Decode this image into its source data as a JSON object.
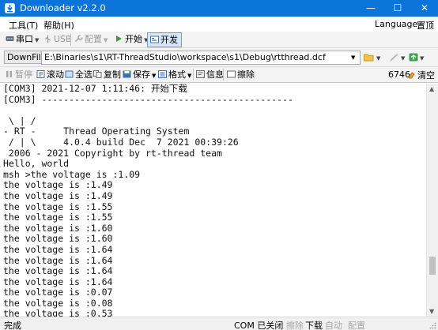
{
  "window": {
    "title": "Downloader v2.2.0",
    "minimize": "—",
    "maximize": "☐",
    "close": "✕"
  },
  "menu": {
    "tools": "工具(T)",
    "help": "帮助(H)",
    "language": "Language",
    "skin": "置顶"
  },
  "toolbar": {
    "serial": "串口",
    "usb": "USB",
    "config": "配置",
    "start": "开始",
    "develop": "开发",
    "dropdown_arrow": "▼"
  },
  "filebar": {
    "label": "DownFile",
    "path": "E:\\Binaries\\s1\\RT-ThreadStudio\\workspace\\s1\\Debug\\rtthread.dcf"
  },
  "toolbar2": {
    "pause": "暂停",
    "scroll": "滚动",
    "select_all": "全选",
    "copy": "复制",
    "save": "保存",
    "format": "格式",
    "info": "信息",
    "erase": "擦除",
    "count": "6746",
    "clear": "清空"
  },
  "console": {
    "lines": [
      "[COM3] 2021-12-07 1:11:46: 开始下载",
      "[COM3] ----------------------------------------------",
      "",
      " \\ | /",
      "- RT -     Thread Operating System",
      " / | \\     4.0.4 build Dec  7 2021 00:39:26",
      " 2006 - 2021 Copyright by rt-thread team",
      "Hello, world",
      "msh >the voltage is :1.09",
      "the voltage is :1.49",
      "the voltage is :1.49",
      "the voltage is :1.55",
      "the voltage is :1.55",
      "the voltage is :1.60",
      "the voltage is :1.60",
      "the voltage is :1.64",
      "the voltage is :1.64",
      "the voltage is :1.64",
      "the voltage is :1.64",
      "the voltage is :0.07",
      "the voltage is :0.08",
      "the voltage is :0.53"
    ]
  },
  "statusbar": {
    "left": "完成",
    "com_status": "COM 已关闭",
    "erase": "擦除",
    "download": "下载",
    "auto": "自动",
    "config": "配置"
  },
  "colors": {
    "titlebar": "#0a74da",
    "develop_active": "#d7e6f7"
  },
  "icons": {
    "app": "app-icon",
    "serial": "serial-port-icon",
    "usb": "usb-icon",
    "config": "wrench-icon",
    "start": "play-icon",
    "develop": "develop-icon",
    "folder": "folder-open-icon",
    "flash": "wand-icon",
    "refresh": "green-refresh-icon"
  }
}
